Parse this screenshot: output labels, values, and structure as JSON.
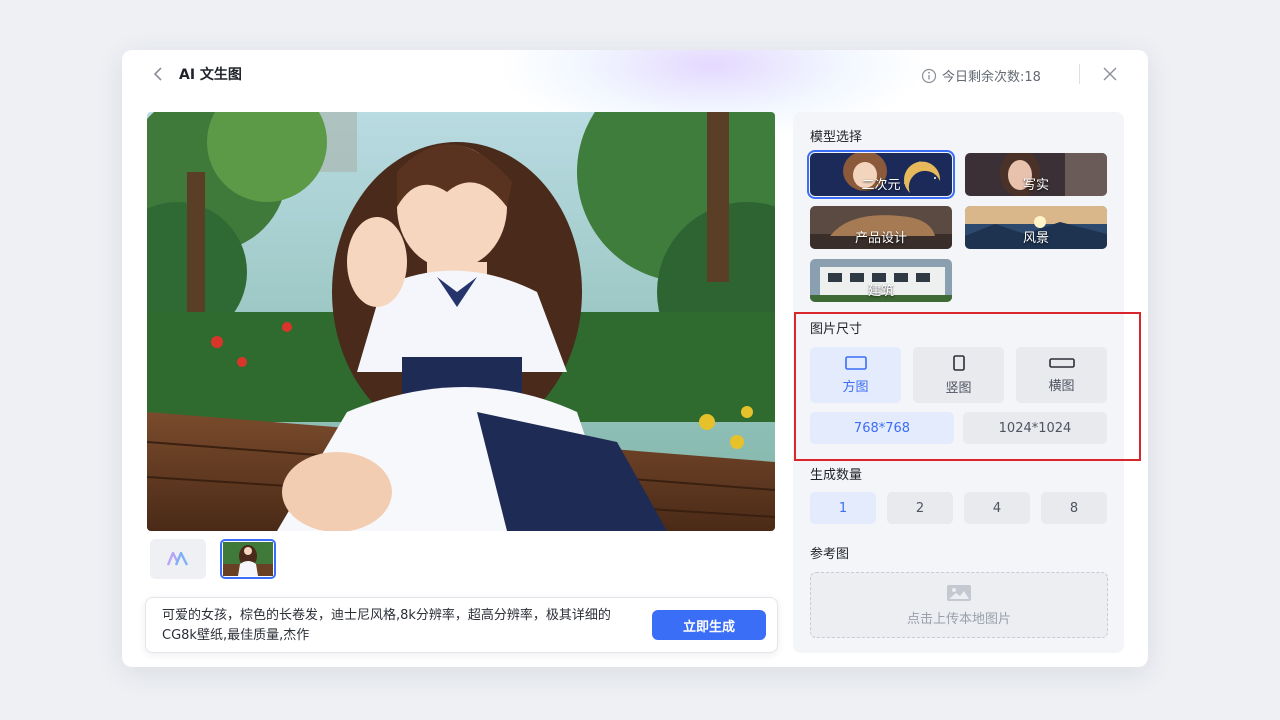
{
  "header": {
    "title": "AI 文生图",
    "remaining_label": "今日剩余次数:18"
  },
  "prompt": {
    "text": "可爱的女孩，棕色的长卷发，迪士尼风格,8k分辨率，超高分辨率，极其详细的CG8k壁纸,最佳质量,杰作",
    "generate_label": "立即生成"
  },
  "panel": {
    "model_title": "模型选择",
    "models": [
      {
        "label": "二次元",
        "selected": true
      },
      {
        "label": "写实",
        "selected": false
      },
      {
        "label": "产品设计",
        "selected": false
      },
      {
        "label": "风景",
        "selected": false
      },
      {
        "label": "建筑",
        "selected": false
      }
    ],
    "size_title": "图片尺寸",
    "orientations": [
      {
        "label": "方图",
        "icon": "square-icon",
        "selected": true
      },
      {
        "label": "竖图",
        "icon": "portrait-icon",
        "selected": false
      },
      {
        "label": "横图",
        "icon": "landscape-icon",
        "selected": false
      }
    ],
    "resolutions": [
      {
        "label": "768*768",
        "selected": true
      },
      {
        "label": "1024*1024",
        "selected": false
      }
    ],
    "count_title": "生成数量",
    "counts": [
      {
        "label": "1",
        "selected": true
      },
      {
        "label": "2",
        "selected": false
      },
      {
        "label": "4",
        "selected": false
      },
      {
        "label": "8",
        "selected": false
      }
    ],
    "reference_title": "参考图",
    "upload_label": "点击上传本地图片"
  },
  "colors": {
    "accent": "#3b6ef6",
    "highlight_box": "#d9262b"
  }
}
